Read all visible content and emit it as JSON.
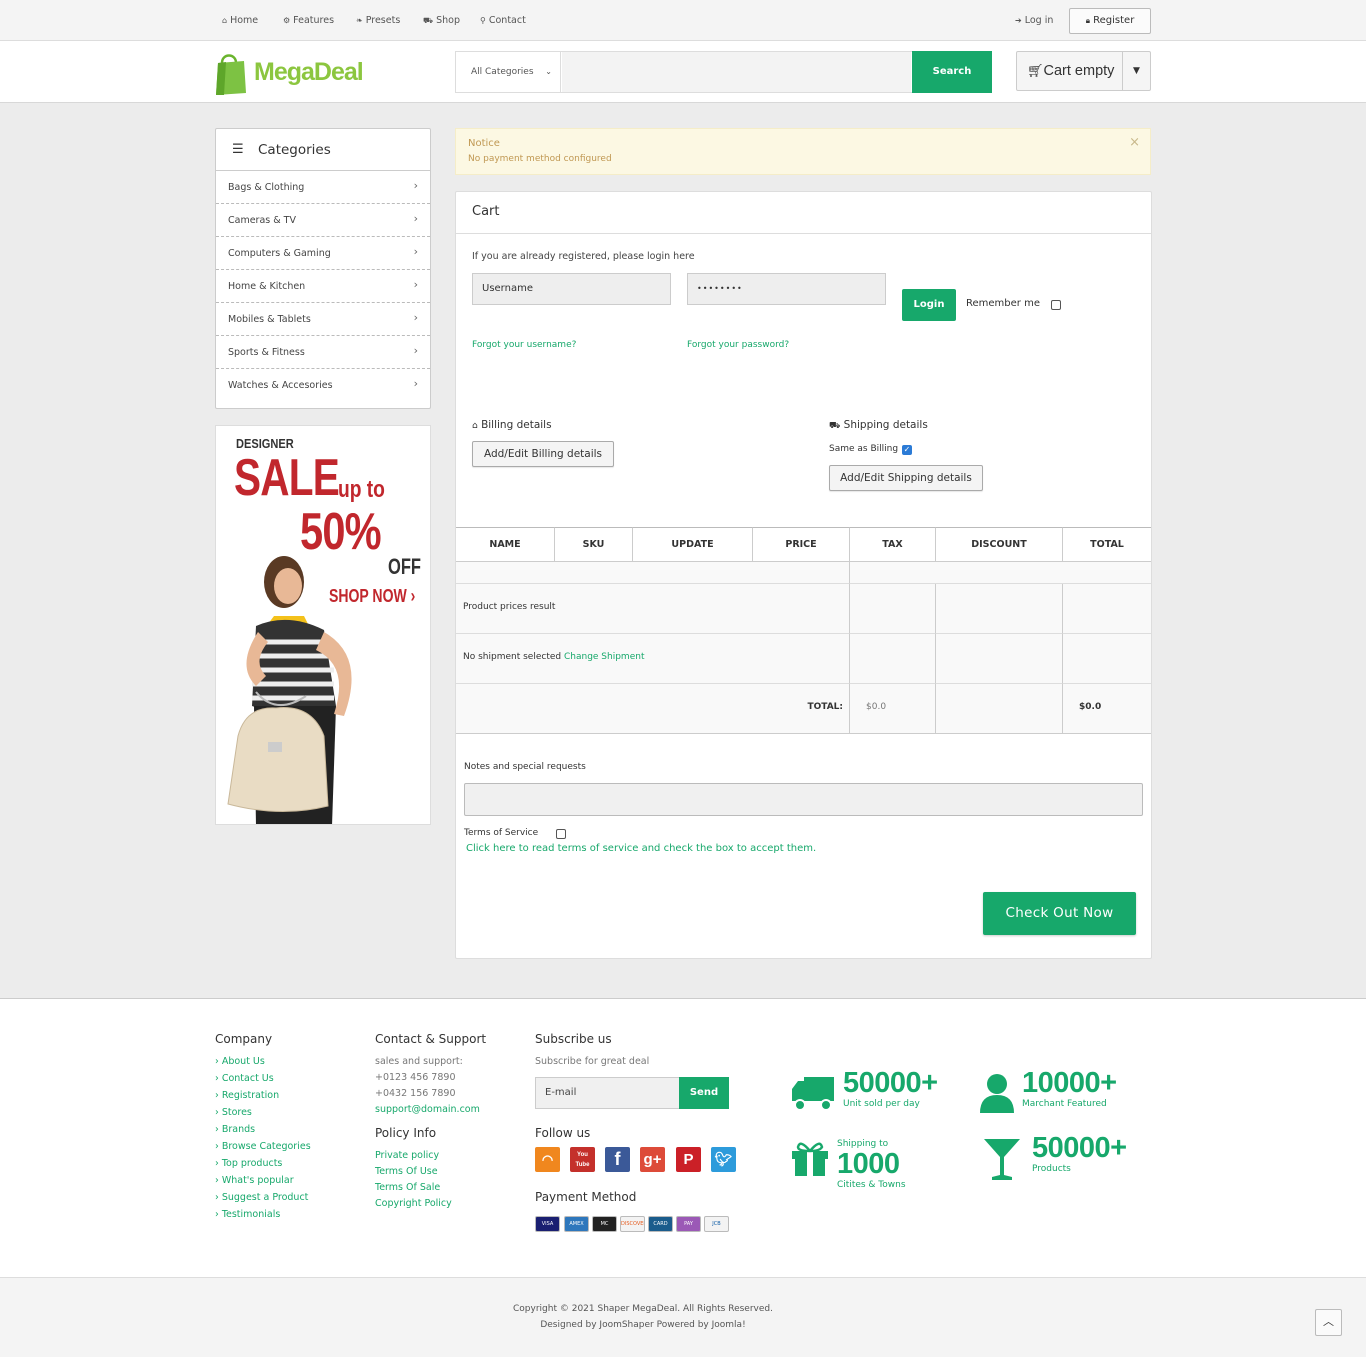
{
  "topbar": {
    "nav": [
      {
        "label": "Home",
        "icon": "home-icon"
      },
      {
        "label": "Features",
        "icon": "gear-icon"
      },
      {
        "label": "Presets",
        "icon": "leaf-icon"
      },
      {
        "label": "Shop",
        "icon": "cart-icon"
      },
      {
        "label": "Contact",
        "icon": "map-marker-icon"
      }
    ],
    "login_label": "Log in",
    "register_label": "Register"
  },
  "header": {
    "logo_text": "MegaDeal",
    "category_select": "All Categories",
    "search_label": "Search",
    "cart_label": "Cart empty"
  },
  "sidebar": {
    "title": "Categories",
    "items": [
      {
        "label": "Bags & Clothing"
      },
      {
        "label": "Cameras & TV"
      },
      {
        "label": "Computers & Gaming"
      },
      {
        "label": "Home & Kitchen"
      },
      {
        "label": "Mobiles & Tablets"
      },
      {
        "label": "Sports & Fitness"
      },
      {
        "label": "Watches & Accesories"
      }
    ],
    "banner": {
      "line1": "DESIGNER",
      "line2": "SALE",
      "line3": "up to",
      "line4": "50%",
      "line5": "OFF",
      "cta": "SHOP NOW"
    }
  },
  "notice": {
    "title": "Notice",
    "message": "No payment method configured",
    "close": "×"
  },
  "cart": {
    "title": "Cart",
    "login_prompt": "If you are already registered, please login here",
    "username_placeholder": "Username",
    "password_value": "••••••••",
    "login_label": "Login",
    "remember_label": "Remember me",
    "forgot_username": "Forgot your username?",
    "forgot_password": "Forgot your password?",
    "billing_title": "Billing details",
    "billing_button": "Add/Edit Billing details",
    "shipping_title": "Shipping details",
    "same_as_billing": "Same as Billing",
    "shipping_button": "Add/Edit Shipping details",
    "columns": [
      "NAME",
      "SKU",
      "UPDATE",
      "PRICE",
      "TAX",
      "DISCOUNT",
      "TOTAL"
    ],
    "product_prices_result": "Product prices result",
    "no_shipment": "No shipment selected",
    "change_shipment": "Change Shipment",
    "total_label": "TOTAL:",
    "total_tax": "$0.0",
    "total_value": "$0.0",
    "notes_label": "Notes and special requests",
    "tos_label": "Terms of Service",
    "tos_link": "Click here to read terms of service and check the box to accept them.",
    "checkout_label": "Check Out Now"
  },
  "footer": {
    "company_title": "Company",
    "company_links": [
      "About Us",
      "Contact Us",
      "Registration",
      "Stores",
      "Brands",
      "Browse Categories",
      "Top products",
      "What's popular",
      "Suggest a Product",
      "Testimonials"
    ],
    "contact_title": "Contact & Support",
    "contact_lines": [
      "sales and support:",
      "+0123 456 7890",
      "+0432 156 7890"
    ],
    "contact_email": "support@domain.com",
    "policy_title": "Policy Info",
    "policy_links": [
      "Private policy",
      "Terms Of Use",
      "Terms Of Sale",
      "Copyright Policy"
    ],
    "subscribe_title": "Subscribe us",
    "subscribe_sub": "Subscribe for great deal",
    "email_placeholder": "E-mail",
    "send_label": "Send",
    "follow_title": "Follow us",
    "payment_title": "Payment Method",
    "payment_cards": [
      "VISA",
      "AMEX",
      "MC",
      "DISCOVER",
      "CARD",
      "PAY",
      "JCB"
    ],
    "stats": [
      {
        "number": "50000+",
        "label": "Unit sold per day",
        "icon": "truck-icon"
      },
      {
        "number": "10000+",
        "label": "Marchant Featured",
        "icon": "user-icon"
      },
      {
        "pre": "Shipping to",
        "number": "1000",
        "label": "Citites & Towns",
        "icon": "gift-icon"
      },
      {
        "number": "50000+",
        "label": "Products",
        "icon": "glass-icon"
      }
    ]
  },
  "copyright": {
    "line1": "Copyright © 2021 Shaper MegaDeal. All Rights Reserved.",
    "line2": "Designed by JoomShaper Powered by Joomla!"
  },
  "colors": {
    "accent": "#17a86b",
    "notice_bg": "#fcf8e3",
    "sale_red": "#c1272d"
  }
}
